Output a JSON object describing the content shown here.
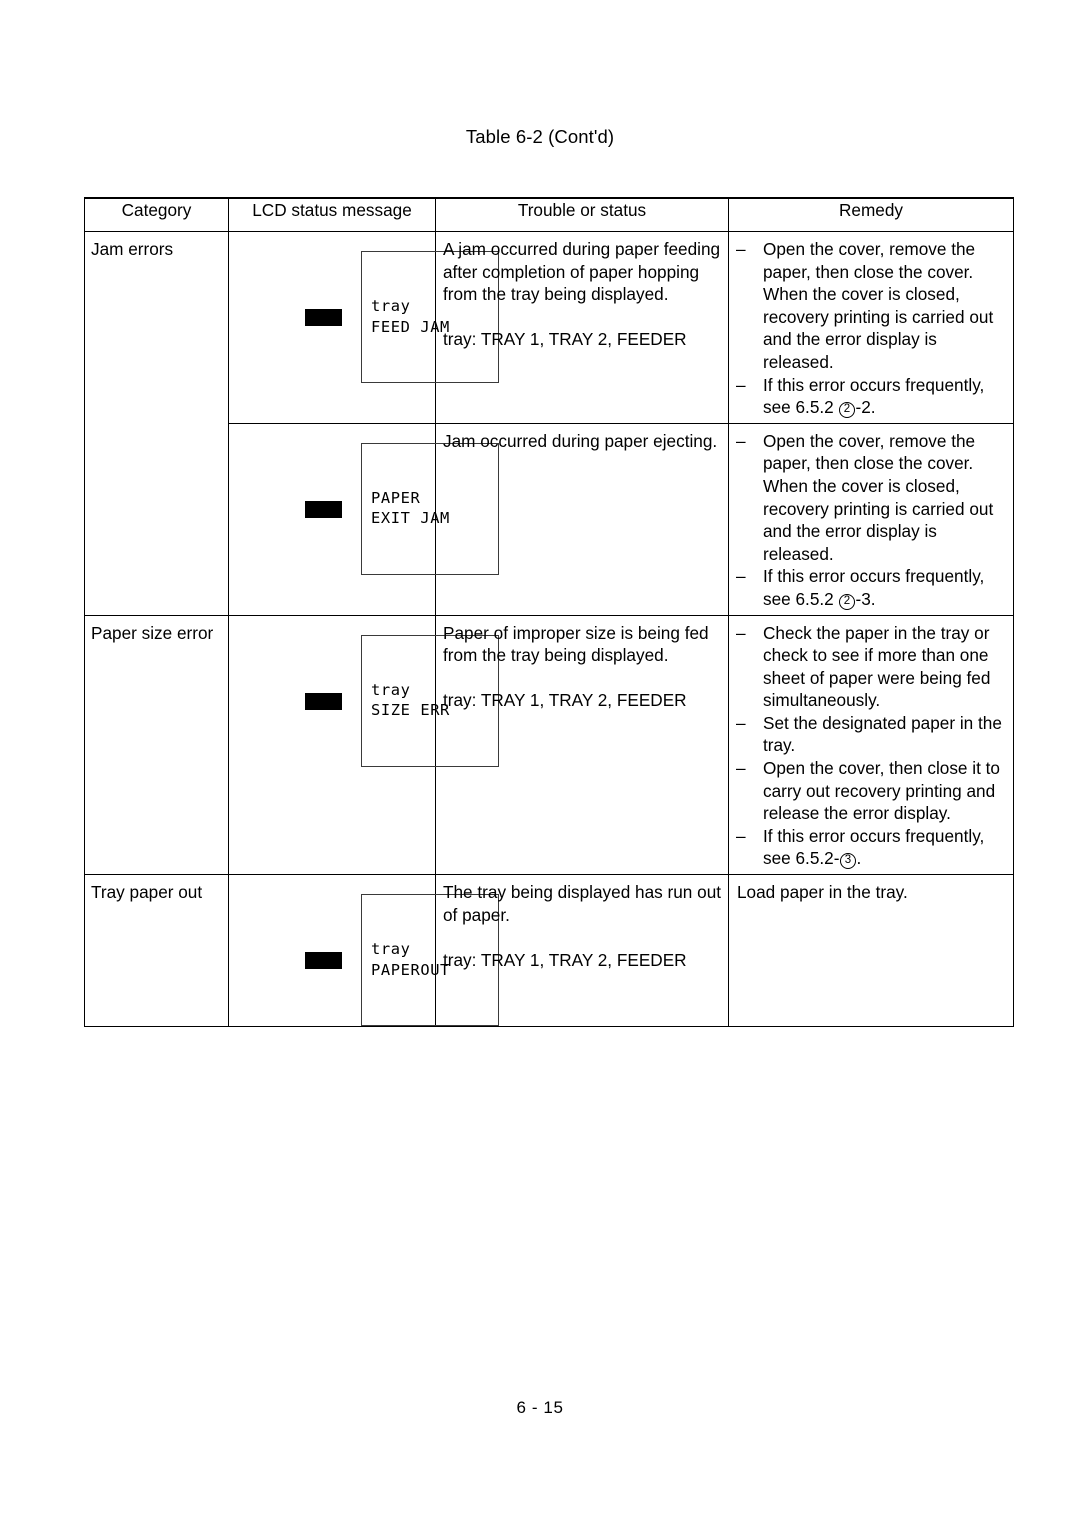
{
  "document": {
    "title": "Table 6-2 (Cont'd)",
    "page_number": "6 - 15"
  },
  "table": {
    "headers": {
      "category": "Category",
      "lcd_status_message": "LCD status message",
      "trouble_or_status": "Trouble or status",
      "remedy": "Remedy"
    },
    "rows": [
      {
        "category": "Jam errors",
        "lcd": {
          "line1": "tray",
          "line2": "FEED JAM",
          "led": "black-indicator"
        },
        "trouble": {
          "paragraph1": "A jam occurred during paper feeding after completion of paper hopping from the tray being displayed.",
          "paragraph2": "tray:  TRAY 1, TRAY 2, FEEDER"
        },
        "remedy_items": [
          {
            "dash": "–",
            "text": "Open the cover, remove the paper, then close the cover. When the cover is closed, recovery printing is carried out and the error display is released."
          },
          {
            "dash": "–",
            "text_before": "If this error occurs frequently, see 6.5.2 ",
            "circled": "2",
            "text_after": "-2."
          }
        ]
      },
      {
        "category": "",
        "lcd": {
          "line1": "PAPER",
          "line2": "EXIT JAM",
          "led": "black-indicator"
        },
        "trouble": {
          "paragraph1": "Jam occurred during paper ejecting.",
          "paragraph2": ""
        },
        "remedy_items": [
          {
            "dash": "–",
            "text": "Open the cover, remove the paper, then close the cover. When the cover is closed, recovery printing is carried out and the error display is released."
          },
          {
            "dash": "–",
            "text_before": "If this error occurs frequently, see 6.5.2 ",
            "circled": "2",
            "text_after": "-3."
          }
        ]
      },
      {
        "category": "Paper size error",
        "lcd": {
          "line1": "tray",
          "line2": "SIZE ERR",
          "led": "black-indicator"
        },
        "trouble": {
          "paragraph1": "Paper of improper size is being fed from the  tray being displayed.",
          "paragraph2": "tray:  TRAY 1, TRAY 2, FEEDER"
        },
        "remedy_items": [
          {
            "dash": "–",
            "text": "Check the paper in the tray or check to see if more than one sheet of paper were being fed simultaneously."
          },
          {
            "dash": "–",
            "text": "Set the designated paper in the tray."
          },
          {
            "dash": "–",
            "text": "Open the cover, then close it to carry out recovery printing and release the error display."
          },
          {
            "dash": "–",
            "text_before": "If this error occurs frequently, see 6.5.2-",
            "circled": "3",
            "text_after": "."
          }
        ]
      },
      {
        "category": "Tray paper out",
        "lcd": {
          "line1": "tray",
          "line2": "PAPEROUT",
          "led": "black-indicator"
        },
        "trouble": {
          "paragraph1": "The tray being displayed has run out of paper.",
          "paragraph2": "tray:  TRAY 1, TRAY 2, FEEDER"
        },
        "remedy_plain": "Load paper in the tray."
      }
    ]
  }
}
